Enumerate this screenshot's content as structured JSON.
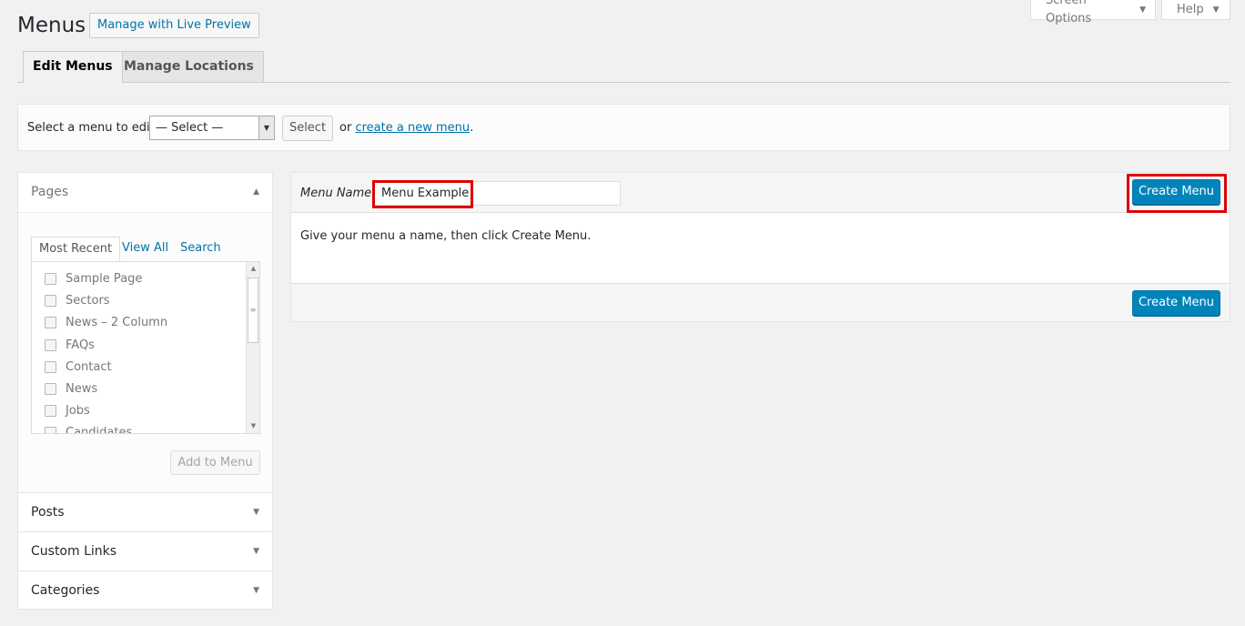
{
  "top_tabs": {
    "screen_options": "Screen Options",
    "help": "Help"
  },
  "header": {
    "title": "Menus",
    "live_preview": "Manage with Live Preview"
  },
  "nav_tabs": [
    {
      "label": "Edit Menus",
      "active": true
    },
    {
      "label": "Manage Locations",
      "active": false
    }
  ],
  "manage": {
    "label": "Select a menu to edit:",
    "select_value": "— Select —",
    "select_button": "Select",
    "or": "or",
    "create_link": "create a new menu",
    "period": "."
  },
  "accordion": {
    "pages": {
      "title": "Pages",
      "tabs": [
        "Most Recent",
        "View All",
        "Search"
      ],
      "items": [
        "Sample Page",
        "Sectors",
        "News – 2 Column",
        "FAQs",
        "Contact",
        "News",
        "Jobs",
        "Candidates"
      ],
      "add_button": "Add to Menu"
    },
    "sections": [
      "Posts",
      "Custom Links",
      "Categories"
    ]
  },
  "menu_edit": {
    "name_label": "Menu Name",
    "name_value": "Menu Example",
    "create_button": "Create Menu",
    "hint": "Give your menu a name, then click Create Menu."
  },
  "colors": {
    "primary": "#0085ba",
    "link": "#0073aa",
    "highlight": "#dd0000",
    "background": "#f1f1f1"
  }
}
